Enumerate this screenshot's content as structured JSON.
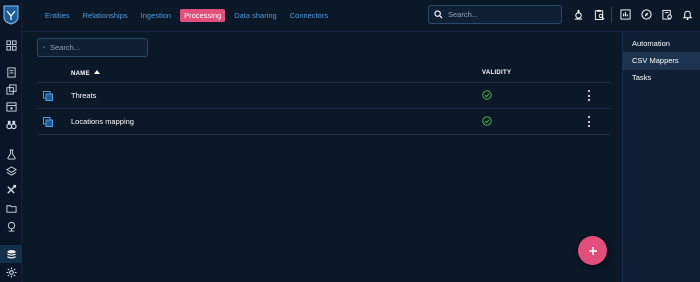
{
  "colors": {
    "background": "#0b1828",
    "accent_link": "#4f9be0",
    "active_pink": "#e34f7c",
    "valid_green": "#4caf50",
    "panel": "#0f2034"
  },
  "topnav": {
    "items": [
      {
        "label": "Entities",
        "active": false
      },
      {
        "label": "Relationships",
        "active": false
      },
      {
        "label": "Ingestion",
        "active": false
      },
      {
        "label": "Processing",
        "active": true
      },
      {
        "label": "Data sharing",
        "active": false
      },
      {
        "label": "Connectors",
        "active": false
      }
    ],
    "search_placeholder": "Search...",
    "icons": [
      "flask-icon",
      "clipboard-search-icon",
      "dashboard-icon",
      "compass-icon",
      "exploration-icon",
      "bell-icon"
    ]
  },
  "leftbar": {
    "icons": [
      "dashboard-icon",
      "analyses-icon",
      "cases-icon",
      "events-icon",
      "observations-icon",
      "threats-icon",
      "arsenal-icon",
      "techniques-icon",
      "entities-icon",
      "locations-icon",
      "data-icon",
      "settings-icon"
    ],
    "active": "data-icon"
  },
  "main": {
    "search_placeholder": "Search...",
    "columns": {
      "name": "NAME",
      "validity": "VALIDITY"
    },
    "rows": [
      {
        "name": "Threats",
        "valid": true
      },
      {
        "name": "Locations mapping",
        "valid": true
      }
    ],
    "fab_label": "+"
  },
  "rightpanel": {
    "items": [
      {
        "label": "Automation",
        "active": false
      },
      {
        "label": "CSV Mappers",
        "active": true
      },
      {
        "label": "Tasks",
        "active": false
      }
    ]
  }
}
